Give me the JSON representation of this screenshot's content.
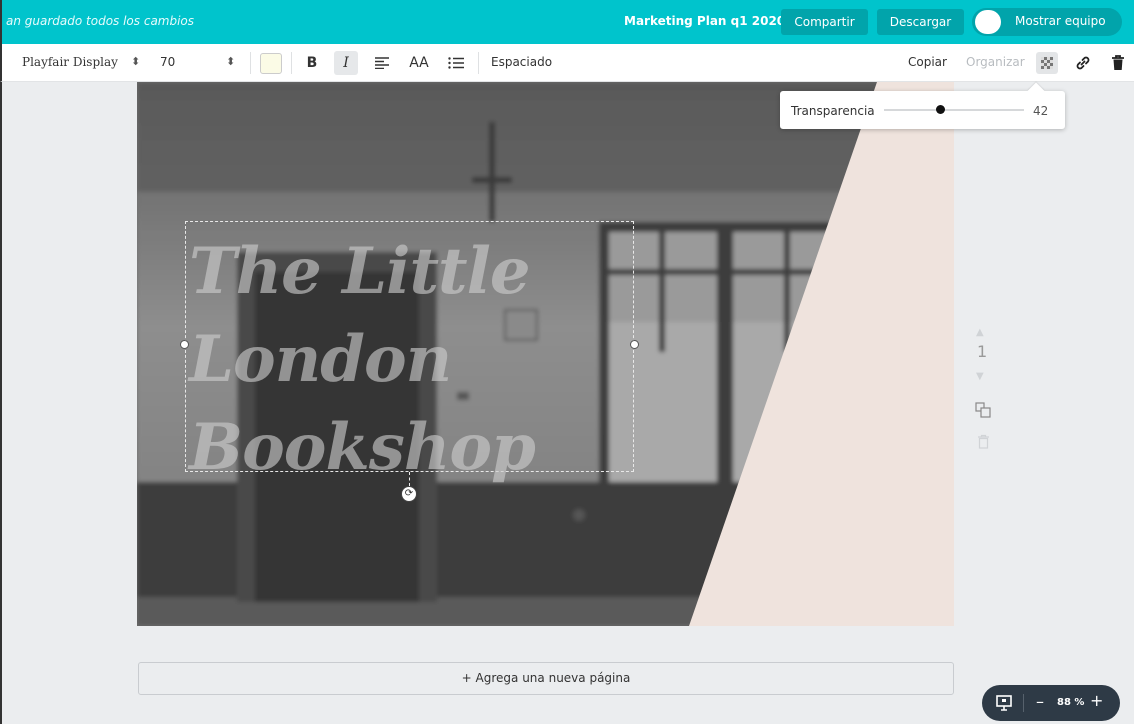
{
  "topbar": {
    "save_status": "an guardado todos los cambios",
    "document_title": "Marketing Plan q1 2020",
    "share_label": "Compartir",
    "download_label": "Descargar",
    "team_toggle_label": "Mostrar equipo"
  },
  "toolbar": {
    "font_family": "Playfair Display",
    "font_size": "70",
    "text_color": "#fbfbe6",
    "bold_label": "B",
    "italic_label": "I",
    "case_label": "AA",
    "spacing_label": "Espaciado",
    "copy_label": "Copiar",
    "arrange_label": "Organizar"
  },
  "transparency": {
    "label": "Transparencia",
    "value": "42"
  },
  "canvas": {
    "headline_lines": [
      "The Little",
      "London",
      "Bookshop"
    ],
    "overlay_color": "#efe3dd"
  },
  "page_controls": {
    "page_number": "1"
  },
  "add_page_label": "+ Agrega una nueva página",
  "zoom": {
    "value": "88 %",
    "minus": "–",
    "plus": "+"
  },
  "colors": {
    "brand": "#00c4cc",
    "brand_dark": "#01a4ab"
  }
}
